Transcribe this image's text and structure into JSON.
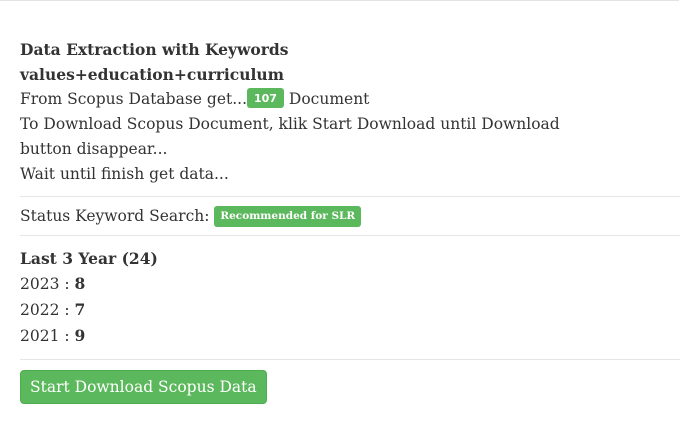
{
  "extraction": {
    "heading": "Data Extraction with Keywords",
    "keywords": "values+education+curriculum",
    "source_prefix": "From Scopus Database get...",
    "document_count": "107",
    "source_suffix": " Document",
    "instruction_line1": "To Download Scopus Document, klik Start Download until Download",
    "instruction_line2": "button disappear...",
    "wait_text": "Wait until finish get data..."
  },
  "status": {
    "label": "Status Keyword Search: ",
    "badge": "Recommended for SLR",
    "badge_color": "#5cb85c"
  },
  "years": {
    "heading": "Last 3 Year (24)",
    "rows": [
      {
        "year": "2023",
        "sep": " : ",
        "count": "8"
      },
      {
        "year": "2022",
        "sep": " : ",
        "count": "7"
      },
      {
        "year": "2021",
        "sep": " : ",
        "count": "9"
      }
    ]
  },
  "actions": {
    "download_button": "Start Download Scopus Data",
    "button_color": "#5cb85c"
  }
}
